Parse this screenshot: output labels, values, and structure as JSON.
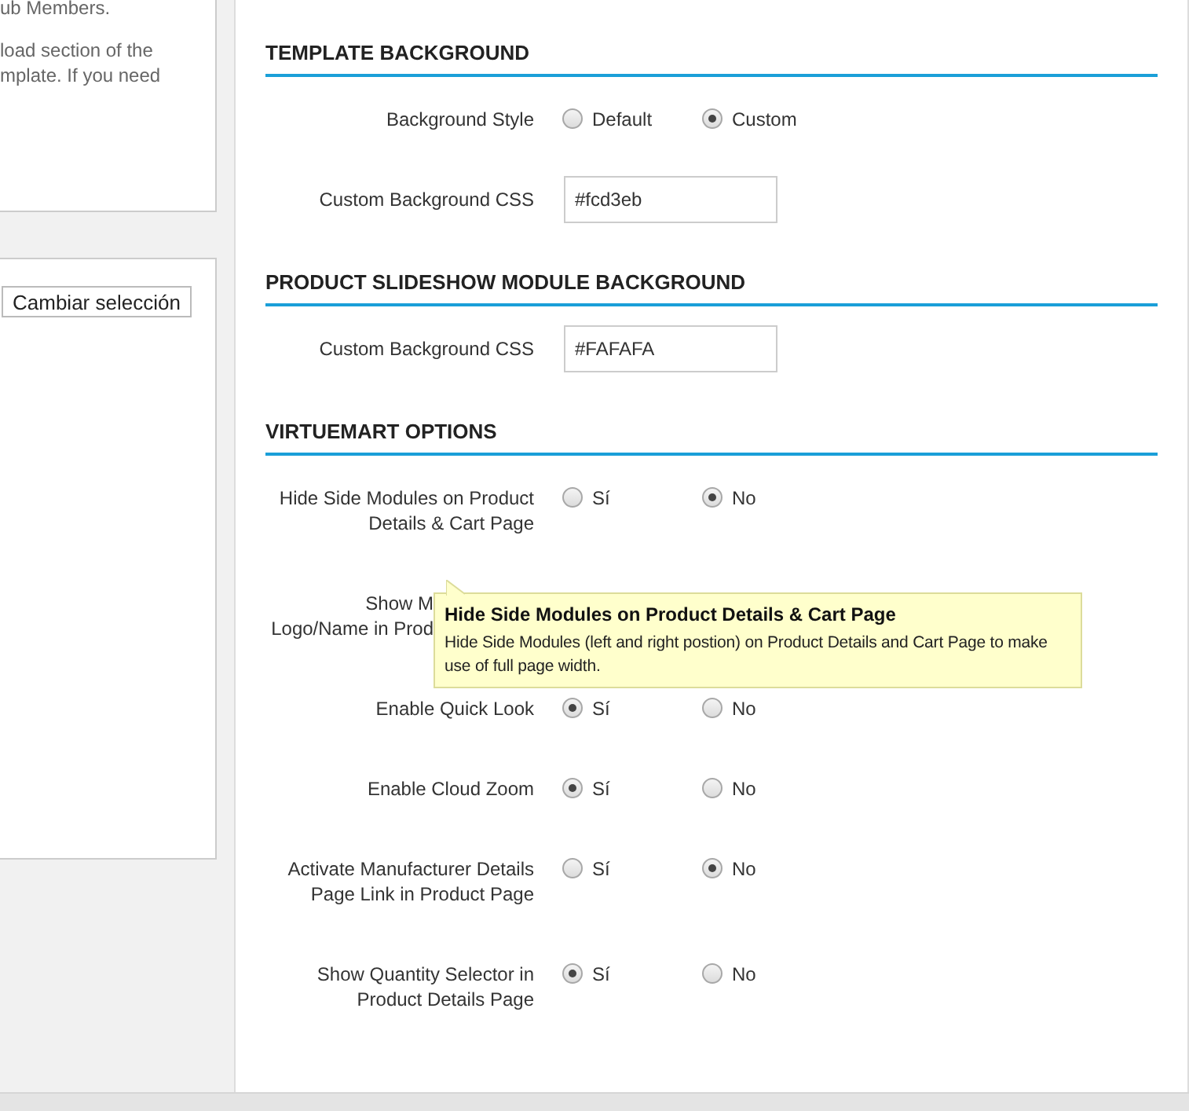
{
  "sidebar": {
    "info_lines": [
      "ub Members.",
      "load section of the",
      "mplate. If you need"
    ],
    "button": "Cambiar selección"
  },
  "sections": [
    {
      "title": "TEMPLATE BACKGROUND",
      "rows": [
        {
          "kind": "radio",
          "label": [
            "Background Style"
          ],
          "options": [
            {
              "label": "Default",
              "selected": false
            },
            {
              "label": "Custom",
              "selected": true
            }
          ]
        },
        {
          "kind": "text",
          "label": [
            "Custom Background CSS"
          ],
          "value": "#fcd3eb"
        }
      ]
    },
    {
      "title": "PRODUCT SLIDESHOW MODULE BACKGROUND",
      "rows": [
        {
          "kind": "text",
          "label": [
            "Custom Background CSS"
          ],
          "value": "#FAFAFA"
        }
      ]
    },
    {
      "title": "VIRTUEMART OPTIONS",
      "rows": [
        {
          "kind": "radio",
          "label": [
            "Hide Side Modules on Product",
            "Details & Cart Page"
          ],
          "options": [
            {
              "label": "Sí",
              "selected": false
            },
            {
              "label": "No",
              "selected": true
            }
          ]
        },
        {
          "kind": "covered",
          "label": [
            "Show M",
            "Logo/Name in Prod"
          ]
        },
        {
          "kind": "radio",
          "label": [
            "Enable Quick Look"
          ],
          "options": [
            {
              "label": "Sí",
              "selected": true
            },
            {
              "label": "No",
              "selected": false
            }
          ]
        },
        {
          "kind": "radio",
          "label": [
            "Enable Cloud Zoom"
          ],
          "options": [
            {
              "label": "Sí",
              "selected": true
            },
            {
              "label": "No",
              "selected": false
            }
          ]
        },
        {
          "kind": "radio",
          "label": [
            "Activate Manufacturer Details",
            "Page Link in Product Page"
          ],
          "options": [
            {
              "label": "Sí",
              "selected": false
            },
            {
              "label": "No",
              "selected": true
            }
          ]
        },
        {
          "kind": "radio",
          "label": [
            "Show Quantity Selector in",
            "Product Details Page"
          ],
          "options": [
            {
              "label": "Sí",
              "selected": true
            },
            {
              "label": "No",
              "selected": false
            }
          ]
        }
      ]
    }
  ],
  "tooltip": {
    "title": "Hide Side Modules on Product Details & Cart Page",
    "text": "Hide Side Modules (left and right postion) on Product Details and Cart Page to make use of full page width."
  }
}
